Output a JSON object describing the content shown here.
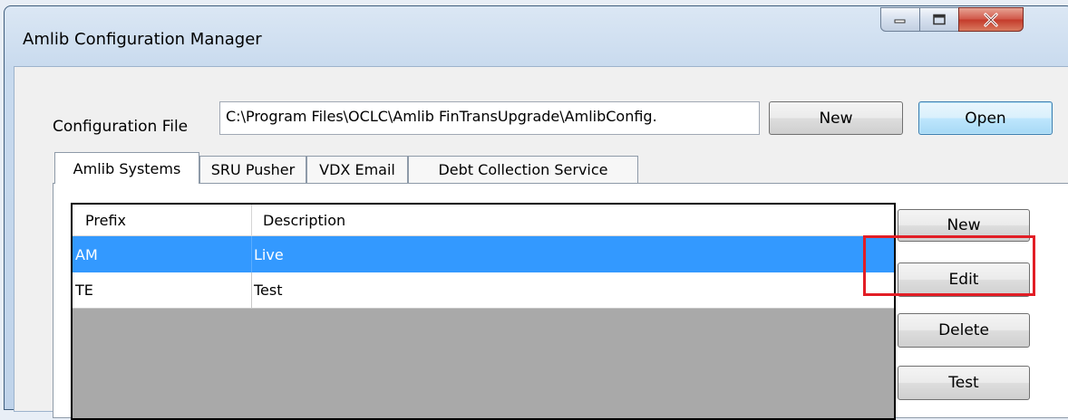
{
  "window": {
    "title": "Amlib Configuration Manager"
  },
  "config": {
    "label": "Configuration File",
    "path": "C:\\Program Files\\OCLC\\Amlib FinTransUpgrade\\AmlibConfig.",
    "new_label": "New",
    "open_label": "Open"
  },
  "tabs": [
    {
      "label": "Amlib Systems",
      "active": true
    },
    {
      "label": "SRU Pusher",
      "active": false
    },
    {
      "label": "VDX Email",
      "active": false
    },
    {
      "label": "Debt Collection Service",
      "active": false
    }
  ],
  "grid": {
    "columns": [
      "Prefix",
      "Description"
    ],
    "rows": [
      {
        "prefix": "AM",
        "description": "Live",
        "selected": true
      },
      {
        "prefix": "TE",
        "description": "Test",
        "selected": false
      }
    ]
  },
  "actions": {
    "new_label": "New",
    "edit_label": "Edit",
    "delete_label": "Delete",
    "test_label": "Test"
  },
  "colors": {
    "selection": "#3399ff",
    "highlight": "#e21e26",
    "close_button": "#c43b2b"
  },
  "icons": [
    "minimize-icon",
    "maximize-icon",
    "close-icon"
  ]
}
